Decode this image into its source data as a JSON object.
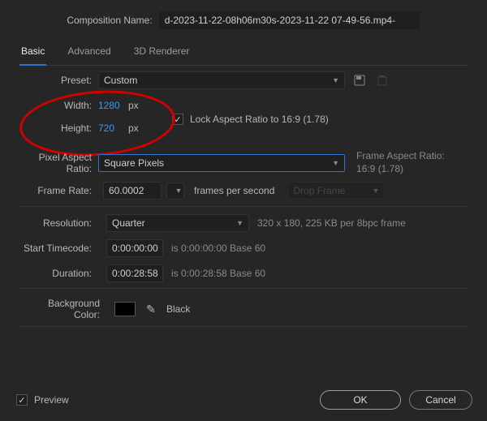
{
  "header": {
    "name_label": "Composition Name:",
    "name_value": "d-2023-11-22-08h06m30s-2023-11-22 07-49-56.mp4-"
  },
  "tabs": {
    "basic": "Basic",
    "advanced": "Advanced",
    "renderer": "3D Renderer",
    "active": "basic"
  },
  "preset": {
    "label": "Preset:",
    "value": "Custom"
  },
  "dims": {
    "width_label": "Width:",
    "width_value": "1280",
    "width_unit": "px",
    "height_label": "Height:",
    "height_value": "720",
    "height_unit": "px",
    "lock_label": "Lock Aspect Ratio to 16:9 (1.78)",
    "lock_checked": true
  },
  "par": {
    "label": "Pixel Aspect Ratio:",
    "value": "Square Pixels",
    "far_label": "Frame Aspect Ratio:",
    "far_value": "16:9 (1.78)"
  },
  "frame_rate": {
    "label": "Frame Rate:",
    "value": "60.0002",
    "unit": "frames per second",
    "drop_label": "Drop Frame"
  },
  "resolution": {
    "label": "Resolution:",
    "value": "Quarter",
    "info": "320 x 180, 225 KB per 8bpc frame"
  },
  "start_tc": {
    "label": "Start Timecode:",
    "value": "0:00:00:00",
    "info": "is 0:00:00:00  Base 60"
  },
  "duration": {
    "label": "Duration:",
    "value": "0:00:28:58",
    "info": "is 0:00:28:58  Base 60"
  },
  "bg": {
    "label": "Background Color:",
    "name": "Black",
    "hex": "#000000"
  },
  "footer": {
    "preview": "Preview",
    "preview_checked": true,
    "ok": "OK",
    "cancel": "Cancel"
  }
}
